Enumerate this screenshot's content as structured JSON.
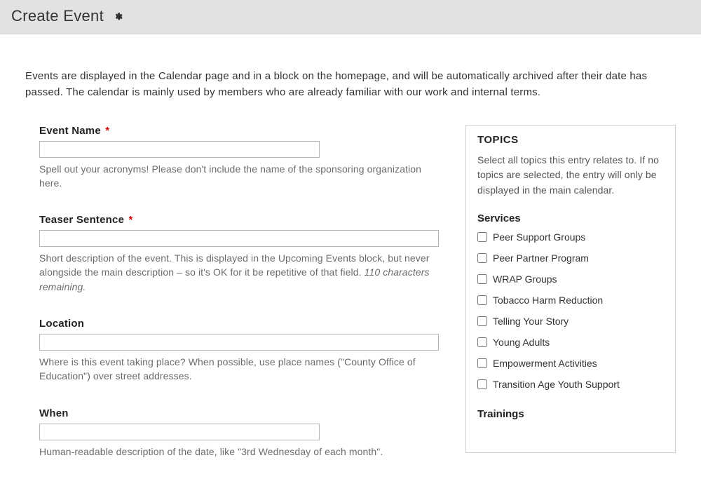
{
  "header": {
    "title": "Create Event"
  },
  "intro_text": "Events are displayed in the Calendar page and in a block on the homepage, and will be automatically archived after their date has passed. The calendar is mainly used by members who are already familiar with our work and internal terms.",
  "fields": {
    "event_name": {
      "label": "Event Name",
      "required_marker": "*",
      "help": "Spell out your acronyms! Please don't include the name of the sponsoring organization here.",
      "value": ""
    },
    "teaser": {
      "label": "Teaser Sentence",
      "required_marker": "*",
      "help_prefix": "Short description of the event. This is displayed in the Upcoming Events block, but never alongside the main description – so it's OK for it be repetitive of that field. ",
      "help_char_count": "110 characters remaining.",
      "value": ""
    },
    "location": {
      "label": "Location",
      "help": "Where is this event taking place? When possible, use place names (\"County Office of Education\") over street addresses.",
      "value": ""
    },
    "when": {
      "label": "When",
      "help": "Human-readable description of the date, like \"3rd Wednesday of each month\".",
      "value": ""
    }
  },
  "topics_panel": {
    "title": "TOPICS",
    "description": "Select all topics this entry relates to. If no topics are selected, the entry will only be displayed in the main calendar.",
    "groups": [
      {
        "title": "Services",
        "items": [
          "Peer Support Groups",
          "Peer Partner Program",
          "WRAP Groups",
          "Tobacco Harm Reduction",
          "Telling Your Story",
          "Young Adults",
          "Empowerment Activities",
          "Transition Age Youth Support"
        ]
      },
      {
        "title": "Trainings",
        "items": []
      }
    ]
  }
}
